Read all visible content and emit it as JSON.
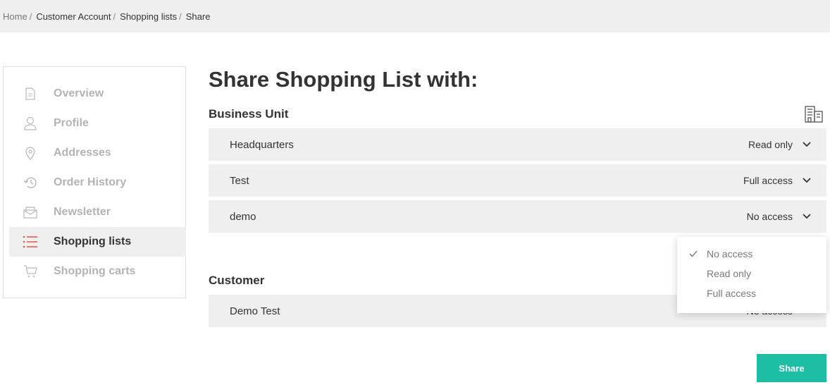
{
  "breadcrumb": {
    "items": [
      {
        "label": "Home"
      },
      {
        "label": "Customer Account"
      },
      {
        "label": "Shopping lists"
      },
      {
        "label": "Share"
      }
    ],
    "separator": "/"
  },
  "sidebar": {
    "items": [
      {
        "label": "Overview",
        "icon": "document-icon",
        "active": false
      },
      {
        "label": "Profile",
        "icon": "user-icon",
        "active": false
      },
      {
        "label": "Addresses",
        "icon": "location-pin-icon",
        "active": false
      },
      {
        "label": "Order History",
        "icon": "history-icon",
        "active": false
      },
      {
        "label": "Newsletter",
        "icon": "envelope-icon",
        "active": false
      },
      {
        "label": "Shopping lists",
        "icon": "list-icon",
        "active": true
      },
      {
        "label": "Shopping carts",
        "icon": "cart-icon",
        "active": false
      }
    ],
    "accent_color": "#e5493a"
  },
  "main": {
    "title": "Share Shopping List with:",
    "business_unit": {
      "label": "Business Unit",
      "rows": [
        {
          "name": "Headquarters",
          "permission": "Read only"
        },
        {
          "name": "Test",
          "permission": "Full access"
        },
        {
          "name": "demo",
          "permission": "No access"
        }
      ]
    },
    "dropdown": {
      "options": [
        "No access",
        "Read only",
        "Full access"
      ],
      "selected": "No access"
    },
    "customer": {
      "label": "Customer",
      "rows": [
        {
          "name": "Demo Test",
          "permission": "No access"
        }
      ]
    },
    "share_button": "Share",
    "button_color": "#1ebea5"
  }
}
